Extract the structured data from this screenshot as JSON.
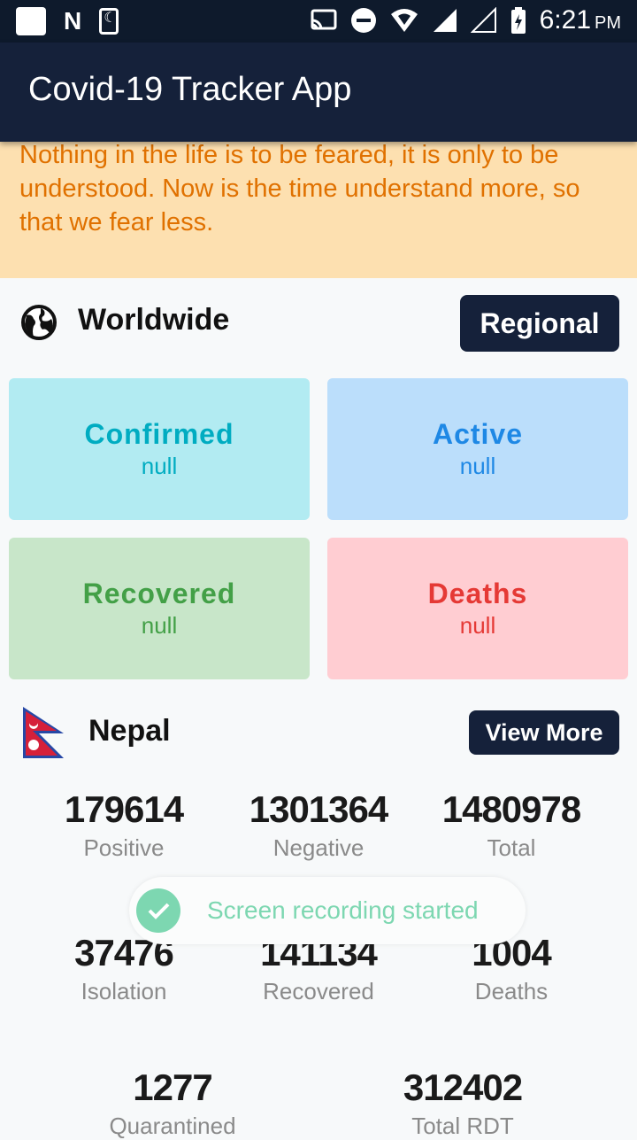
{
  "status_bar": {
    "time": "6:21",
    "ampm": "PM",
    "n_glyph": "N"
  },
  "app_bar": {
    "title": "Covid-19 Tracker App"
  },
  "quote": "Nothing in the life is to be feared, it is only to be understood. Now is the time understand more, so that we fear less.",
  "worldwide": {
    "title": "Worldwide",
    "button": "Regional",
    "cards": [
      {
        "label": "Confirmed",
        "value": "null",
        "bg": "#b2ebf2",
        "fg": "#00acc1"
      },
      {
        "label": "Active",
        "value": "null",
        "bg": "#bbdefb",
        "fg": "#1e88e5"
      },
      {
        "label": "Recovered",
        "value": "null",
        "bg": "#c8e6c9",
        "fg": "#43a047"
      },
      {
        "label": "Deaths",
        "value": "null",
        "bg": "#ffcdd2",
        "fg": "#e53935"
      }
    ]
  },
  "nepal": {
    "title": "Nepal",
    "button": "View More",
    "stats": [
      {
        "value": "179614",
        "label": "Positive"
      },
      {
        "value": "1301364",
        "label": "Negative"
      },
      {
        "value": "1480978",
        "label": "Total"
      },
      {
        "value": "37476",
        "label": "Isolation"
      },
      {
        "value": "141134",
        "label": "Recovered"
      },
      {
        "value": "1004",
        "label": "Deaths"
      },
      {
        "value": "1277",
        "label": "Quarantined"
      },
      {
        "value": "312402",
        "label": "Total RDT"
      }
    ]
  },
  "toast": {
    "text": "Screen recording started"
  },
  "colors": {
    "primary": "#15213a",
    "quote_bg": "#fde0b0",
    "quote_fg": "#e07100",
    "toast": "#7dd7b1"
  }
}
